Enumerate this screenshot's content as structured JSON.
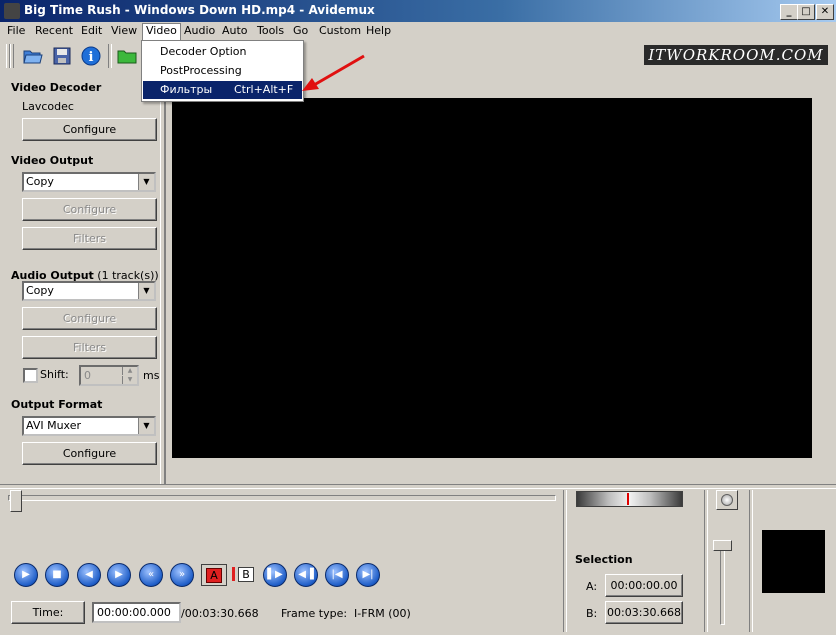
{
  "window": {
    "title": "Big Time Rush - Windows Down HD.mp4 - Avidemux"
  },
  "menubar": [
    "File",
    "Recent",
    "Edit",
    "View",
    "Video",
    "Audio",
    "Auto",
    "Tools",
    "Go",
    "Custom",
    "Help"
  ],
  "watermark": "ITWORKROOM.COM",
  "video_menu": {
    "items": [
      {
        "label": "Decoder Option",
        "shortcut": ""
      },
      {
        "label": "PostProcessing",
        "shortcut": ""
      },
      {
        "label": "Фильтры",
        "shortcut": "Ctrl+Alt+F"
      }
    ]
  },
  "left_panel": {
    "video_decoder": {
      "header": "Video Decoder",
      "codec": "Lavcodec",
      "configure": "Configure"
    },
    "video_output": {
      "header": "Video Output",
      "value": "Copy",
      "configure": "Configure",
      "filters": "Filters"
    },
    "audio_output": {
      "header": "Audio Output",
      "tracks": "(1 track(s))",
      "value": "Copy",
      "configure": "Configure",
      "filters": "Filters",
      "shift_label": "Shift:",
      "shift_value": "0",
      "shift_unit": "ms"
    },
    "output_format": {
      "header": "Output Format",
      "value": "AVI Muxer",
      "configure": "Configure"
    }
  },
  "bottom": {
    "time_button": "Time:",
    "current_time": "00:00:00.000",
    "total_time": "/00:03:30.668",
    "frame_type": "Frame type:  I-FRM (00)",
    "marker_a": "A",
    "marker_b": "B",
    "selection": {
      "header": "Selection",
      "a_label": "A:",
      "a_value": "00:00:00.00",
      "b_label": "B:",
      "b_value": "00:03:30.668"
    }
  }
}
